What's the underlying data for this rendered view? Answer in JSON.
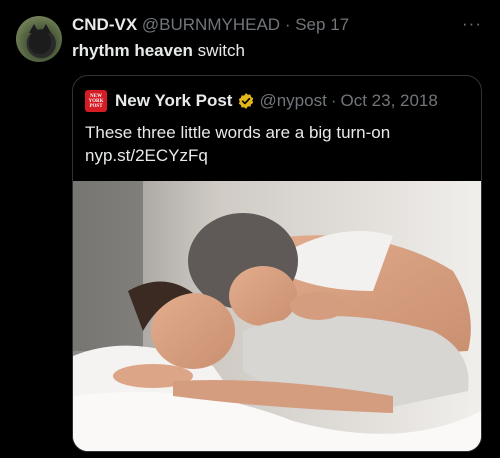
{
  "tweet": {
    "author_name": "CND-VX",
    "handle": "@BURNMYHEAD",
    "separator": "·",
    "date": "Sep 17",
    "text_bold": "rhythm heaven",
    "text_rest": " switch",
    "more_icon": "more-horizontal-icon"
  },
  "quoted": {
    "author_name": "New York Post",
    "logo_lines": [
      "NEW",
      "YORK",
      "POST"
    ],
    "handle": "@nypost",
    "separator": "·",
    "date": "Oct 23, 2018",
    "text": "These three little words are a big turn-on",
    "link": "nyp.st/2ECYzFq",
    "verified_color": "#e2b719"
  },
  "colors": {
    "background": "#000000",
    "text": "#e7e9ea",
    "muted": "#71767b",
    "border": "#2f3336",
    "nyp_red": "#d51c25"
  }
}
